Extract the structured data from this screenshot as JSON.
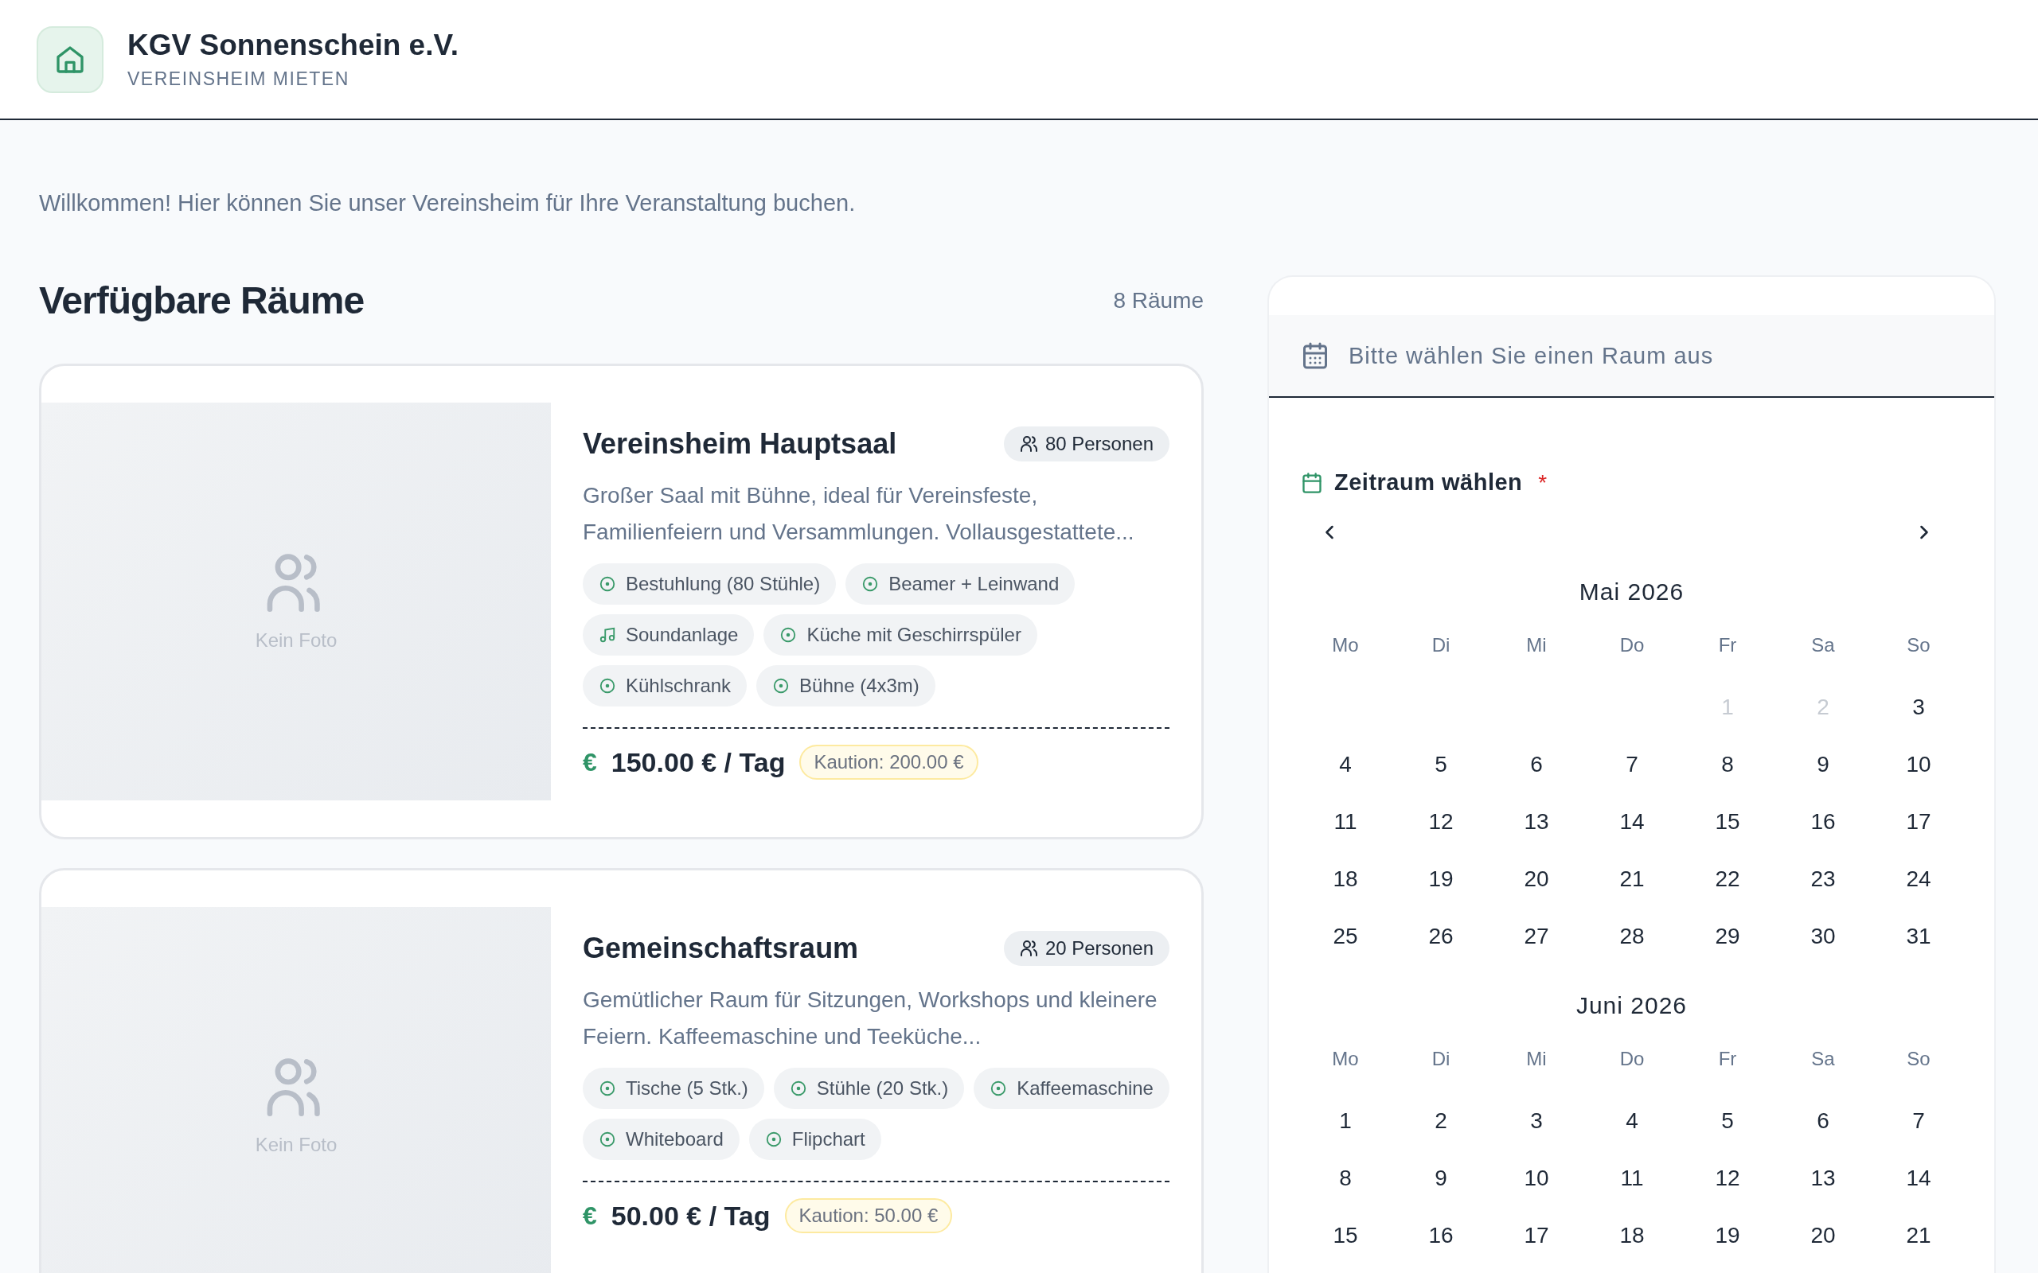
{
  "header": {
    "title": "KGV Sonnenschein e.V.",
    "subtitle": "VEREINSHEIM MIETEN"
  },
  "welcome": "Willkommen! Hier können Sie unser Vereinsheim für Ihre Veranstaltung buchen.",
  "rooms_heading": "Verfügbare Räume",
  "rooms_count": "8 Räume",
  "rooms": [
    {
      "image_label": "Kein Foto",
      "name": "Vereinsheim Hauptsaal",
      "capacity": "80 Personen",
      "description": "Großer Saal mit Bühne, ideal für Vereinsfeste, Familienfeiern und Versammlungen. Vollausgestattete...",
      "features": [
        {
          "kind": "check",
          "label": "Bestuhlung (80 Stühle)"
        },
        {
          "kind": "check",
          "label": "Beamer + Leinwand"
        },
        {
          "kind": "music",
          "label": "Soundanlage"
        },
        {
          "kind": "check",
          "label": "Küche mit Geschirrspüler"
        },
        {
          "kind": "check",
          "label": "Kühlschrank"
        },
        {
          "kind": "check",
          "label": "Bühne (4x3m)"
        }
      ],
      "currency_icon": "€",
      "price": "150.00 € / Tag",
      "deposit": "Kaution: 200.00 €"
    },
    {
      "image_label": "Kein Foto",
      "name": "Gemeinschaftsraum",
      "capacity": "20 Personen",
      "description": "Gemütlicher Raum für Sitzungen, Workshops und kleinere Feiern. Kaffeemaschine und Teeküche...",
      "features": [
        {
          "kind": "check",
          "label": "Tische (5 Stk.)"
        },
        {
          "kind": "check",
          "label": "Stühle (20 Stk.)"
        },
        {
          "kind": "check",
          "label": "Kaffeemaschine"
        },
        {
          "kind": "check",
          "label": "Whiteboard"
        },
        {
          "kind": "check",
          "label": "Flipchart"
        }
      ],
      "currency_icon": "€",
      "price": "50.00 € / Tag",
      "deposit": "Kaution: 50.00 €"
    }
  ],
  "booking": {
    "room_prompt": "Bitte wählen Sie einen Raum aus",
    "period_label": "Zeitraum wählen",
    "required_mark": "*",
    "months": [
      {
        "title": "Mai 2026",
        "weekdays": [
          "Mo",
          "Di",
          "Mi",
          "Do",
          "Fr",
          "Sa",
          "So"
        ],
        "weeks": [
          [
            {
              "kind": "blank"
            },
            {
              "kind": "blank"
            },
            {
              "kind": "blank"
            },
            {
              "kind": "blank"
            },
            {
              "kind": "day",
              "label": "1",
              "disabled": true
            },
            {
              "kind": "day",
              "label": "2",
              "disabled": true
            },
            {
              "kind": "day",
              "label": "3",
              "disabled": false
            }
          ],
          [
            {
              "kind": "day",
              "label": "4",
              "disabled": false
            },
            {
              "kind": "day",
              "label": "5",
              "disabled": false
            },
            {
              "kind": "day",
              "label": "6",
              "disabled": false
            },
            {
              "kind": "day",
              "label": "7",
              "disabled": false
            },
            {
              "kind": "day",
              "label": "8",
              "disabled": false
            },
            {
              "kind": "day",
              "label": "9",
              "disabled": false
            },
            {
              "kind": "day",
              "label": "10",
              "disabled": false
            }
          ],
          [
            {
              "kind": "day",
              "label": "11",
              "disabled": false
            },
            {
              "kind": "day",
              "label": "12",
              "disabled": false
            },
            {
              "kind": "day",
              "label": "13",
              "disabled": false
            },
            {
              "kind": "day",
              "label": "14",
              "disabled": false
            },
            {
              "kind": "day",
              "label": "15",
              "disabled": false
            },
            {
              "kind": "day",
              "label": "16",
              "disabled": false
            },
            {
              "kind": "day",
              "label": "17",
              "disabled": false
            }
          ],
          [
            {
              "kind": "day",
              "label": "18",
              "disabled": false
            },
            {
              "kind": "day",
              "label": "19",
              "disabled": false
            },
            {
              "kind": "day",
              "label": "20",
              "disabled": false
            },
            {
              "kind": "day",
              "label": "21",
              "disabled": false
            },
            {
              "kind": "day",
              "label": "22",
              "disabled": false
            },
            {
              "kind": "day",
              "label": "23",
              "disabled": false
            },
            {
              "kind": "day",
              "label": "24",
              "disabled": false
            }
          ],
          [
            {
              "kind": "day",
              "label": "25",
              "disabled": false
            },
            {
              "kind": "day",
              "label": "26",
              "disabled": false
            },
            {
              "kind": "day",
              "label": "27",
              "disabled": false
            },
            {
              "kind": "day",
              "label": "28",
              "disabled": false
            },
            {
              "kind": "day",
              "label": "29",
              "disabled": false
            },
            {
              "kind": "day",
              "label": "30",
              "disabled": false
            },
            {
              "kind": "day",
              "label": "31",
              "disabled": false
            }
          ]
        ]
      },
      {
        "title": "Juni 2026",
        "weekdays": [
          "Mo",
          "Di",
          "Mi",
          "Do",
          "Fr",
          "Sa",
          "So"
        ],
        "weeks": [
          [
            {
              "kind": "day",
              "label": "1",
              "disabled": false
            },
            {
              "kind": "day",
              "label": "2",
              "disabled": false
            },
            {
              "kind": "day",
              "label": "3",
              "disabled": false
            },
            {
              "kind": "day",
              "label": "4",
              "disabled": false
            },
            {
              "kind": "day",
              "label": "5",
              "disabled": false
            },
            {
              "kind": "day",
              "label": "6",
              "disabled": false
            },
            {
              "kind": "day",
              "label": "7",
              "disabled": false
            }
          ],
          [
            {
              "kind": "day",
              "label": "8",
              "disabled": false
            },
            {
              "kind": "day",
              "label": "9",
              "disabled": false
            },
            {
              "kind": "day",
              "label": "10",
              "disabled": false
            },
            {
              "kind": "day",
              "label": "11",
              "disabled": false
            },
            {
              "kind": "day",
              "label": "12",
              "disabled": false
            },
            {
              "kind": "day",
              "label": "13",
              "disabled": false
            },
            {
              "kind": "day",
              "label": "14",
              "disabled": false
            }
          ],
          [
            {
              "kind": "day",
              "label": "15",
              "disabled": false
            },
            {
              "kind": "day",
              "label": "16",
              "disabled": false
            },
            {
              "kind": "day",
              "label": "17",
              "disabled": false
            },
            {
              "kind": "day",
              "label": "18",
              "disabled": false
            },
            {
              "kind": "day",
              "label": "19",
              "disabled": false
            },
            {
              "kind": "day",
              "label": "20",
              "disabled": false
            },
            {
              "kind": "day",
              "label": "21",
              "disabled": false
            }
          ]
        ]
      }
    ]
  }
}
